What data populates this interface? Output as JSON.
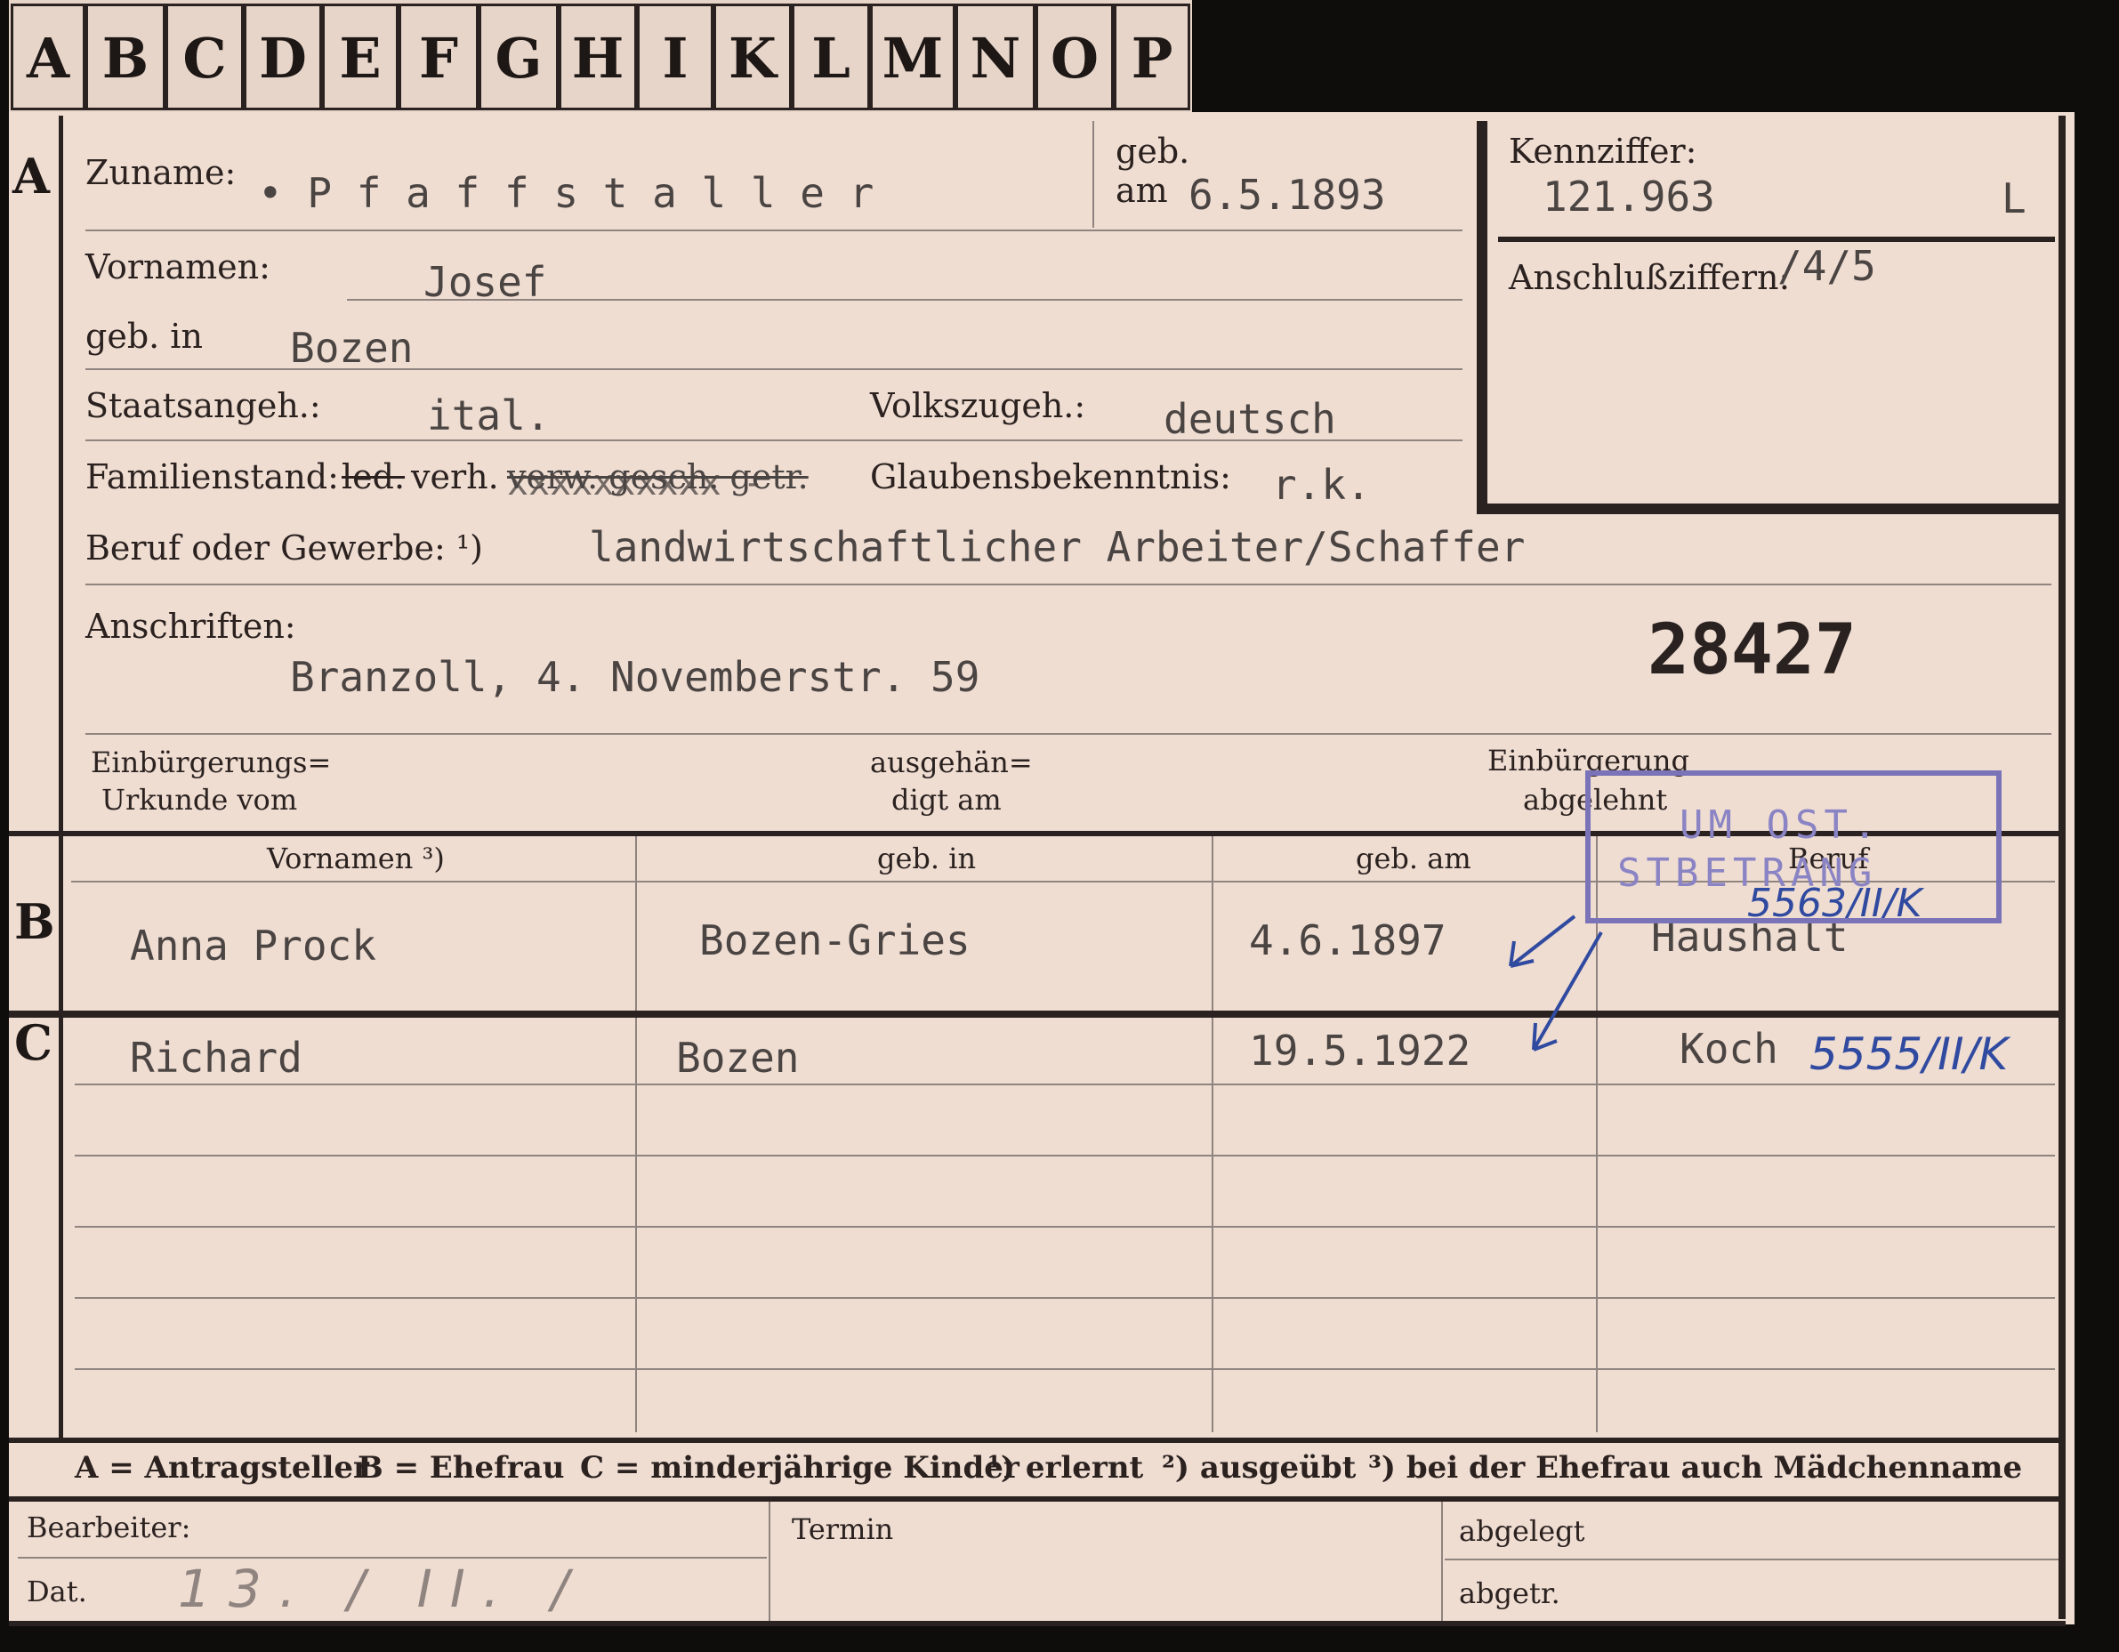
{
  "tabs": [
    "A",
    "B",
    "C",
    "D",
    "E",
    "F",
    "G",
    "H",
    "I",
    "K",
    "L",
    "M",
    "N",
    "O",
    "P"
  ],
  "section_a": {
    "marker": "A",
    "surname_label": "Zuname:",
    "surname_value": "• P f a f f s t a l l e r",
    "born_label_1": "geb.",
    "born_label_2": "am",
    "born_value": "6.5.1893",
    "kennziffer_label": "Kennziffer:",
    "kennziffer_value": "121.963",
    "kennziffer_suffix": "L",
    "anschluss_label": "Anschlußziffern:",
    "anschluss_value": "/4/5",
    "vornamen_label": "Vornamen:",
    "vornamen_value": "Josef",
    "geb_in_label": "geb. in",
    "geb_in_value": "Bozen",
    "staat_label": "Staatsangeh.:",
    "staat_value": "ital.",
    "volk_label": "Volkszugeh.:",
    "volk_value": "deutsch",
    "familien_label": "Familienstand:",
    "familien_led": "led.",
    "familien_verh": "verh.",
    "familien_struck": "verw. gesch. getr.",
    "familien_xx": "xxxxxxxxxx -",
    "glauben_label": "Glaubensbekenntnis:",
    "glauben_value": "r.k.",
    "beruf_label": "Beruf oder Gewerbe: ¹)",
    "beruf_value": "landwirtschaftlicher Arbeiter/Schaffer",
    "anschriften_label": "Anschriften:",
    "anschriften_value": "Branzoll, 4. Novemberstr. 59",
    "number": "28427",
    "einb_label_1": "Einbürgerungs=",
    "einb_label_2": "Urkunde vom",
    "ausgeh_label_1": "ausgehän=",
    "ausgeh_label_2": "digt am",
    "abgelehnt_label_1": "Einbürgerung",
    "abgelehnt_label_2": "abgelehnt"
  },
  "stamp": {
    "line1": "UM OST.",
    "line2": "STBETRANG"
  },
  "section_b": {
    "marker": "B",
    "headers": [
      "Vornamen ³)",
      "geb. in",
      "geb. am",
      "Beruf"
    ],
    "row": [
      "Anna Prock",
      "Bozen-Gries",
      "4.6.1897",
      "Haushalt"
    ],
    "annotation": "5563/II/K"
  },
  "section_c": {
    "marker": "C",
    "row": [
      "Richard",
      "Bozen",
      "19.5.1922",
      "Koch"
    ],
    "annotation": "5555/II/K"
  },
  "legend": {
    "a": "A = Antragsteller",
    "b": "B = Ehefrau",
    "c": "C = minderjährige Kinder",
    "n1": "¹) erlernt",
    "n2": "²) ausgeübt",
    "n3": "³) bei der Ehefrau auch Mädchenname"
  },
  "footer": {
    "bearbeiter_label": "Bearbeiter:",
    "dat_label": "Dat.",
    "dat_value": "13. / II. /",
    "termin_label": "Termin",
    "abgelegt_label": "abgelegt",
    "abgetr_label": "abgetr."
  },
  "colors": {
    "paper": "#efddd2",
    "ink": "#2a2220",
    "stamp": "#7a73b8",
    "pen": "#304aa0",
    "background": "#0f0d0c"
  }
}
